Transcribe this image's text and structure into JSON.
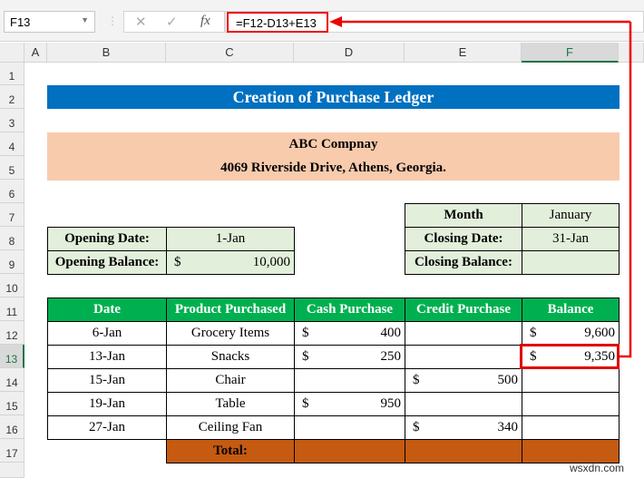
{
  "formula_bar": {
    "name_box": "F13",
    "cancel_icon": "✕",
    "enter_icon": "✓",
    "fx_label": "fx",
    "formula": "=F12-D13+E13"
  },
  "columns": [
    "A",
    "B",
    "C",
    "D",
    "E",
    "F"
  ],
  "selected_column": "F",
  "rows": [
    "1",
    "2",
    "3",
    "4",
    "5",
    "6",
    "7",
    "8",
    "9",
    "10",
    "11",
    "12",
    "13",
    "14",
    "15",
    "16",
    "17"
  ],
  "selected_row": "13",
  "title": "Creation of Purchase Ledger",
  "company": {
    "name": "ABC Compnay",
    "address": "4069 Riverside Drive, Athens, Georgia."
  },
  "opening": {
    "date_label": "Opening Date:",
    "date": "1-Jan",
    "balance_label": "Opening Balance:",
    "currency": "$",
    "balance": "10,000"
  },
  "closing": {
    "month_label": "Month",
    "month": "January",
    "date_label": "Closing Date:",
    "date": "31-Jan",
    "balance_label": "Closing Balance:",
    "balance": ""
  },
  "ledger": {
    "headers": [
      "Date",
      "Product Purchased",
      "Cash Purchase",
      "Credit Purchase",
      "Balance"
    ],
    "rows": [
      {
        "date": "6-Jan",
        "product": "Grocery Items",
        "cash": "400",
        "credit": "",
        "balance": "9,600"
      },
      {
        "date": "13-Jan",
        "product": "Snacks",
        "cash": "250",
        "credit": "",
        "balance": "9,350"
      },
      {
        "date": "15-Jan",
        "product": "Chair",
        "cash": "",
        "credit": "500",
        "balance": ""
      },
      {
        "date": "19-Jan",
        "product": "Table",
        "cash": "950",
        "credit": "",
        "balance": ""
      },
      {
        "date": "27-Jan",
        "product": "Ceiling Fan",
        "cash": "",
        "credit": "340",
        "balance": ""
      }
    ],
    "currency": "$",
    "total_label": "Total:"
  },
  "watermark": "wsxdn.com",
  "colors": {
    "title": "#0070C0",
    "company": "#F8CBAD",
    "info": "#E2EFDA",
    "header": "#00B050",
    "total": "#C55A11",
    "highlight": "#E00000"
  }
}
